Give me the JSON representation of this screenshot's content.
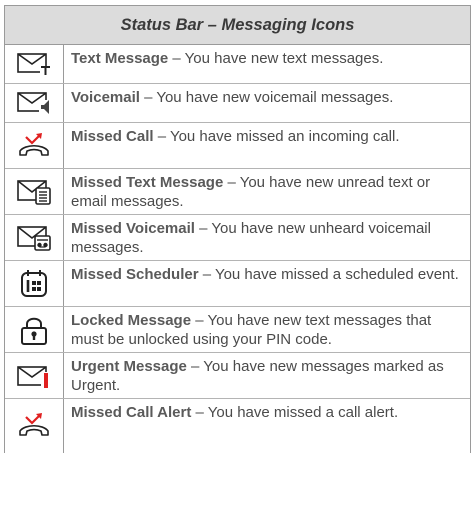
{
  "title": "Status Bar – Messaging Icons",
  "separator": " – ",
  "colors": {
    "icon_stroke": "#222222",
    "missed_red": "#e02020",
    "header_bg": "#dcdcdc"
  },
  "rows": [
    {
      "icon": "text-message-icon",
      "term": "Text Message",
      "desc": "You have new text messages."
    },
    {
      "icon": "voicemail-icon",
      "term": "Voicemail",
      "desc": "You have new voicemail messages."
    },
    {
      "icon": "missed-call-icon",
      "term": "Missed Call",
      "desc": "You have missed an incoming call."
    },
    {
      "icon": "missed-text-message-icon",
      "term": "Missed Text Message",
      "desc": "You have new unread text or email messages."
    },
    {
      "icon": "missed-voicemail-icon",
      "term": "Missed Voicemail",
      "desc": "You have new unheard voicemail messages."
    },
    {
      "icon": "missed-scheduler-icon",
      "term": "Missed Scheduler",
      "desc": "You have missed a scheduled event."
    },
    {
      "icon": "locked-message-icon",
      "term": "Locked Message",
      "desc": "You have new text messages that must be unlocked using your PIN code."
    },
    {
      "icon": "urgent-message-icon",
      "term": "Urgent Message",
      "desc": "You have new messages marked as Urgent."
    },
    {
      "icon": "missed-call-alert-icon",
      "term": "Missed Call Alert",
      "desc": "You have missed a call alert."
    }
  ]
}
